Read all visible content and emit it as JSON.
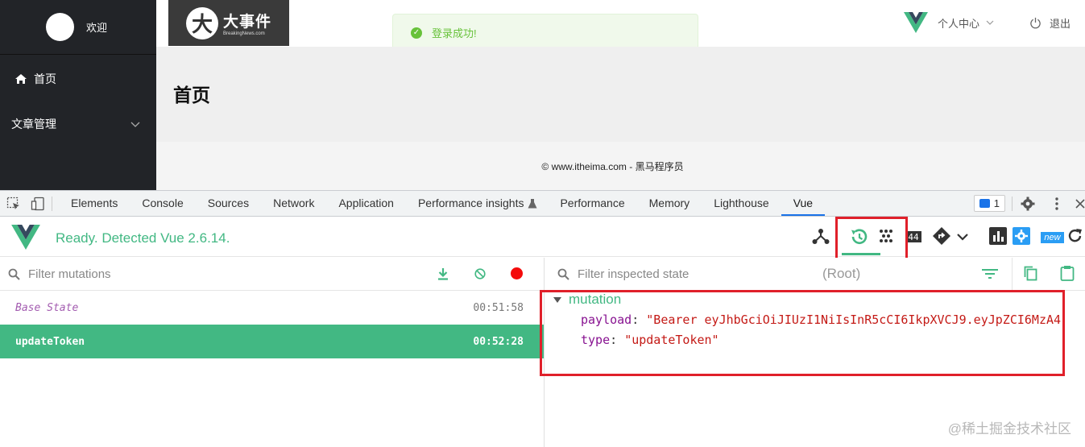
{
  "app": {
    "sidebar": {
      "welcome": "欢迎",
      "items": [
        {
          "label": "首页",
          "icon": "home-icon"
        },
        {
          "label": "文章管理",
          "icon": "chevron-down-icon"
        }
      ]
    },
    "header": {
      "logo_title": "大事件",
      "logo_subtitle": "BreakingNews.com",
      "personal_center": "个人中心",
      "logout": "退出"
    },
    "toast": {
      "message": "登录成功!"
    },
    "main": {
      "title": "首页",
      "copyright": "© www.itheima.com - 黑马程序员"
    }
  },
  "devtools": {
    "tabs": [
      "Elements",
      "Console",
      "Sources",
      "Network",
      "Application",
      "Performance insights",
      "Performance",
      "Memory",
      "Lighthouse",
      "Vue"
    ],
    "active_tab": "Vue",
    "issues_count": "1",
    "vue": {
      "status": "Ready. Detected Vue 2.6.14.",
      "perf_badge": "44",
      "new_badge": "new",
      "mutations_filter_placeholder": "Filter mutations",
      "mutations": [
        {
          "name": "Base State",
          "time": "00:51:58"
        },
        {
          "name": "updateToken",
          "time": "00:52:28",
          "selected": true
        }
      ],
      "state_filter_placeholder": "Filter inspected state",
      "root_label": "(Root)",
      "inspected": {
        "section": "mutation",
        "fields": [
          {
            "key": "payload",
            "value": "\"Bearer eyJhbGciOiJIUzI1NiIsInR5cCI6IkpXVCJ9.eyJpZCI6MzA4"
          },
          {
            "key": "type",
            "value": "\"updateToken\""
          }
        ]
      }
    }
  },
  "watermark": "@稀土掘金技术社区",
  "colors": {
    "vue_green": "#42b883",
    "highlight_red": "#e0202a",
    "sidebar_bg": "#222428",
    "success": "#67c23a"
  }
}
